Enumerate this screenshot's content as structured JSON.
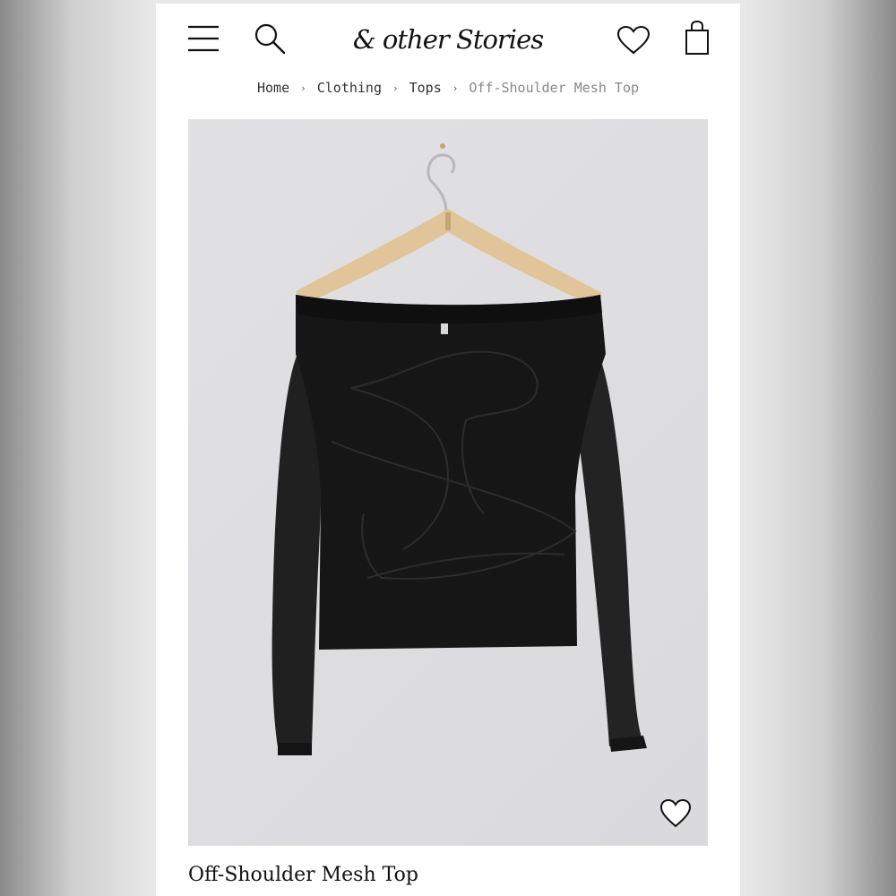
{
  "brand": {
    "logo_text": "& other Stories"
  },
  "header": {
    "icons": [
      "hamburger-menu-icon",
      "search-icon",
      "heart-icon",
      "shopping-bag-icon"
    ]
  },
  "breadcrumb": {
    "items": [
      "Home",
      "Clothing",
      "Tops"
    ],
    "current": "Off-Shoulder Mesh Top",
    "separator": "›"
  },
  "product": {
    "title": "Off-Shoulder Mesh Top",
    "image_background": "#dedee1",
    "garment_color": "#161616",
    "hanger_color": "#e2c49a"
  }
}
